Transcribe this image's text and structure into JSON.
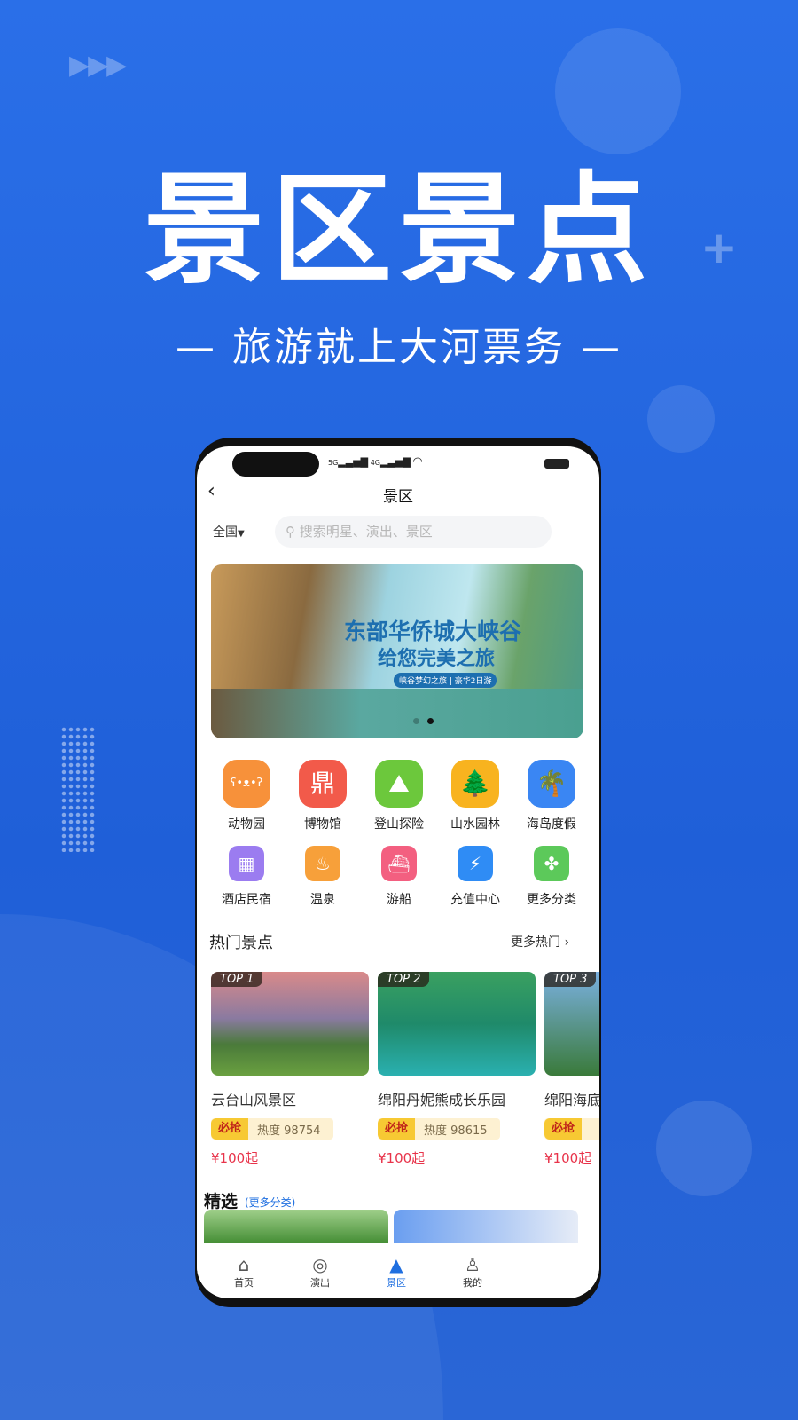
{
  "hero": {
    "title": "景区景点",
    "subtitle": "— 旅游就上大河票务 —"
  },
  "status": {
    "net1": "5G",
    "net2": "4G"
  },
  "nav": {
    "title": "景区"
  },
  "search": {
    "region": "全国",
    "placeholder": "搜索明星、演出、景区"
  },
  "banner": {
    "line1": "东部华侨城大峡谷",
    "line2": "给您完美之旅",
    "tag": "峡谷梦幻之旅 | 豪华2日游",
    "active_dot": 2,
    "dots": 2
  },
  "categories": [
    {
      "label": "动物园",
      "icon": "panda-icon",
      "color": "#f7913a"
    },
    {
      "label": "博物馆",
      "icon": "cauldron-icon",
      "color": "#f25a4a"
    },
    {
      "label": "登山探险",
      "icon": "hiker-icon",
      "color": "#6cc83c"
    },
    {
      "label": "山水园林",
      "icon": "forest-icon",
      "color": "#f8b31f"
    },
    {
      "label": "海岛度假",
      "icon": "palm-island-icon",
      "color": "#3a86f3"
    },
    {
      "label": "酒店民宿",
      "icon": "hotel-icon",
      "color": "#9b7cf0"
    },
    {
      "label": "温泉",
      "icon": "hot-spring-icon",
      "color": "#f7a03a"
    },
    {
      "label": "游船",
      "icon": "ship-icon",
      "color": "#f35f80"
    },
    {
      "label": "充值中心",
      "icon": "lightning-shield-icon",
      "color": "#2f8cf5"
    },
    {
      "label": "更多分类",
      "icon": "grid-icon",
      "color": "#5cc95a"
    }
  ],
  "hot": {
    "title": "热门景点",
    "more": "更多热门",
    "items": [
      {
        "rank": "TOP 1",
        "name": "云台山风景区",
        "badge": "必抢",
        "heat": "热度 98754",
        "price": "¥100起"
      },
      {
        "rank": "TOP 2",
        "name": "绵阳丹妮熊成长乐园",
        "badge": "必抢",
        "heat": "热度 98615",
        "price": "¥100起"
      },
      {
        "rank": "TOP 3",
        "name": "绵阳海底世界",
        "badge": "必抢",
        "heat": "",
        "price": "¥100起"
      }
    ]
  },
  "featured": {
    "title": "精选",
    "more": "(更多分类)"
  },
  "tabs": [
    {
      "label": "首页",
      "icon": "home-icon"
    },
    {
      "label": "演出",
      "icon": "music-disc-icon"
    },
    {
      "label": "景区",
      "icon": "mountain-icon",
      "active": true
    },
    {
      "label": "我的",
      "icon": "user-icon"
    }
  ],
  "colors": {
    "accent": "#1f6fe0",
    "price": "#e8334a",
    "background": "#2264dc"
  }
}
